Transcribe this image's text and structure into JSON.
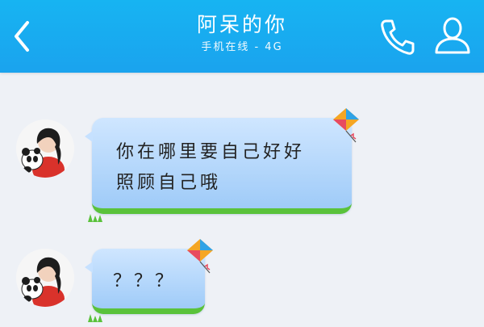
{
  "header": {
    "title": "阿呆的你",
    "subtitle": "手机在线 - 4G",
    "back_icon": "chevron-left-icon",
    "call_icon": "phone-icon",
    "profile_icon": "person-icon",
    "accent_color": "#17b4f2"
  },
  "messages": [
    {
      "sender": "contact",
      "lines": [
        "你在哪里要自己好好",
        "照顾自己哦"
      ],
      "bubble_theme": "blue-sky-kite"
    },
    {
      "sender": "contact",
      "lines": [
        "？？？"
      ],
      "bubble_theme": "blue-sky-kite"
    }
  ]
}
